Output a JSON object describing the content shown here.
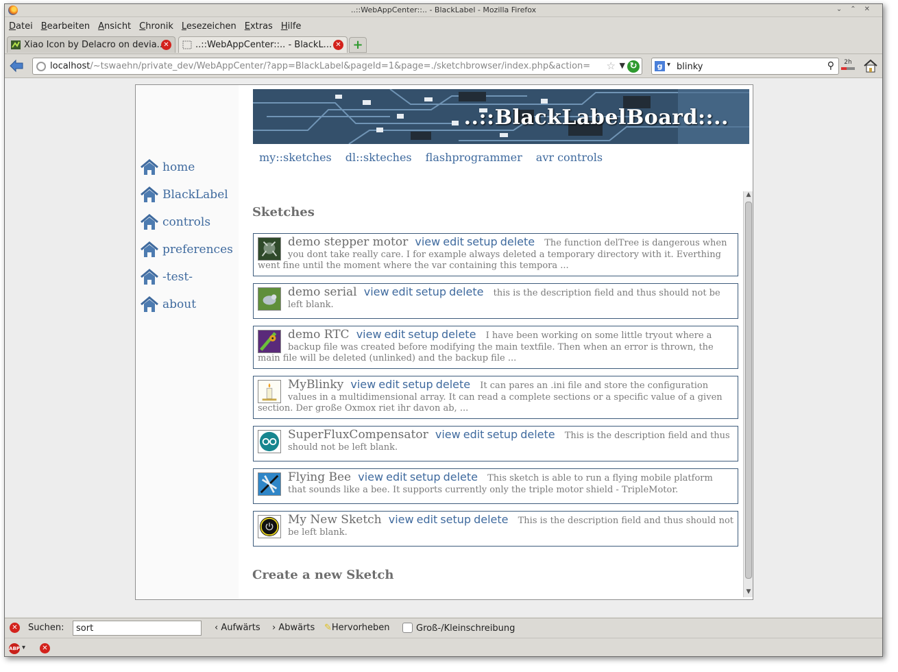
{
  "window": {
    "title": "..::WebAppCenter::.. - BlackLabel - Mozilla Firefox"
  },
  "menubar": [
    "Datei",
    "Bearbeiten",
    "Ansicht",
    "Chronik",
    "Lesezeichen",
    "Extras",
    "Hilfe"
  ],
  "tabs": [
    {
      "label": "Xiao Icon by Delacro on devia...",
      "active": false
    },
    {
      "label": "..::WebAppCenter::.. - BlackL...",
      "active": true
    }
  ],
  "navbar": {
    "url_host": "localhost",
    "url_path": "/~tswaehn/private_dev/WebAppCenter/?app=BlackLabel&pageId=1&page=./sketchbrowser/index.php&action=",
    "search_value": "blinky",
    "ext_label": "2h"
  },
  "site": {
    "banner_title": "..::BlackLabelBoard::..",
    "sidebar": [
      "home",
      "BlackLabel",
      "controls",
      "preferences",
      "-test-",
      "about"
    ],
    "topnav": [
      "my::sketches",
      "dl::skteches",
      "flashprogrammer",
      "avr controls"
    ],
    "sketches_heading": "Sketches",
    "create_heading": "Create a new Sketch",
    "actions": [
      "view",
      "edit",
      "setup",
      "delete"
    ],
    "sketches": [
      {
        "name": "demo stepper motor",
        "icon": "robot-icon",
        "desc": "The function delTree is dangerous when you dont take really care. I for example always deleted a temporary directory with it. Everthing went fine until the moment where the var containing this tempora ..."
      },
      {
        "name": "demo serial",
        "icon": "bird-icon",
        "desc": "this is the description field and thus should not be left blank."
      },
      {
        "name": "demo RTC",
        "icon": "ladybug-icon",
        "desc": "I have been working on some little tryout where a backup file was created before modifying the main textfile. Then when an error is thrown, the main file will be deleted (unlinked) and the backup file ..."
      },
      {
        "name": "MyBlinky",
        "icon": "candle-icon",
        "desc": "It can pares an .ini file and store the configuration values in a multidimensional array. It can read a complete sections or a specific value of a given section. Der große Oxmox riet ihr davon ab, ..."
      },
      {
        "name": "SuperFluxCompensator",
        "icon": "arduino-icon",
        "desc": "This is the description field and thus should not be left blank."
      },
      {
        "name": "Flying Bee",
        "icon": "dragonfly-icon",
        "desc": "This sketch is able to run a flying mobile platform that sounds like a bee. It supports currently only the triple motor shield - TripleMotor."
      },
      {
        "name": "My New Sketch",
        "icon": "power-icon",
        "desc": "This is the description field and thus should not be left blank."
      }
    ]
  },
  "findbar": {
    "label": "Suchen:",
    "value": "sort",
    "up": "Aufwärts",
    "down": "Abwärts",
    "highlight": "Hervorheben",
    "matchcase": "Groß-/Kleinschreibung"
  },
  "colors": {
    "link": "#3f6a9e",
    "card_border": "#3d5b7b",
    "close_red": "#d3221c"
  }
}
